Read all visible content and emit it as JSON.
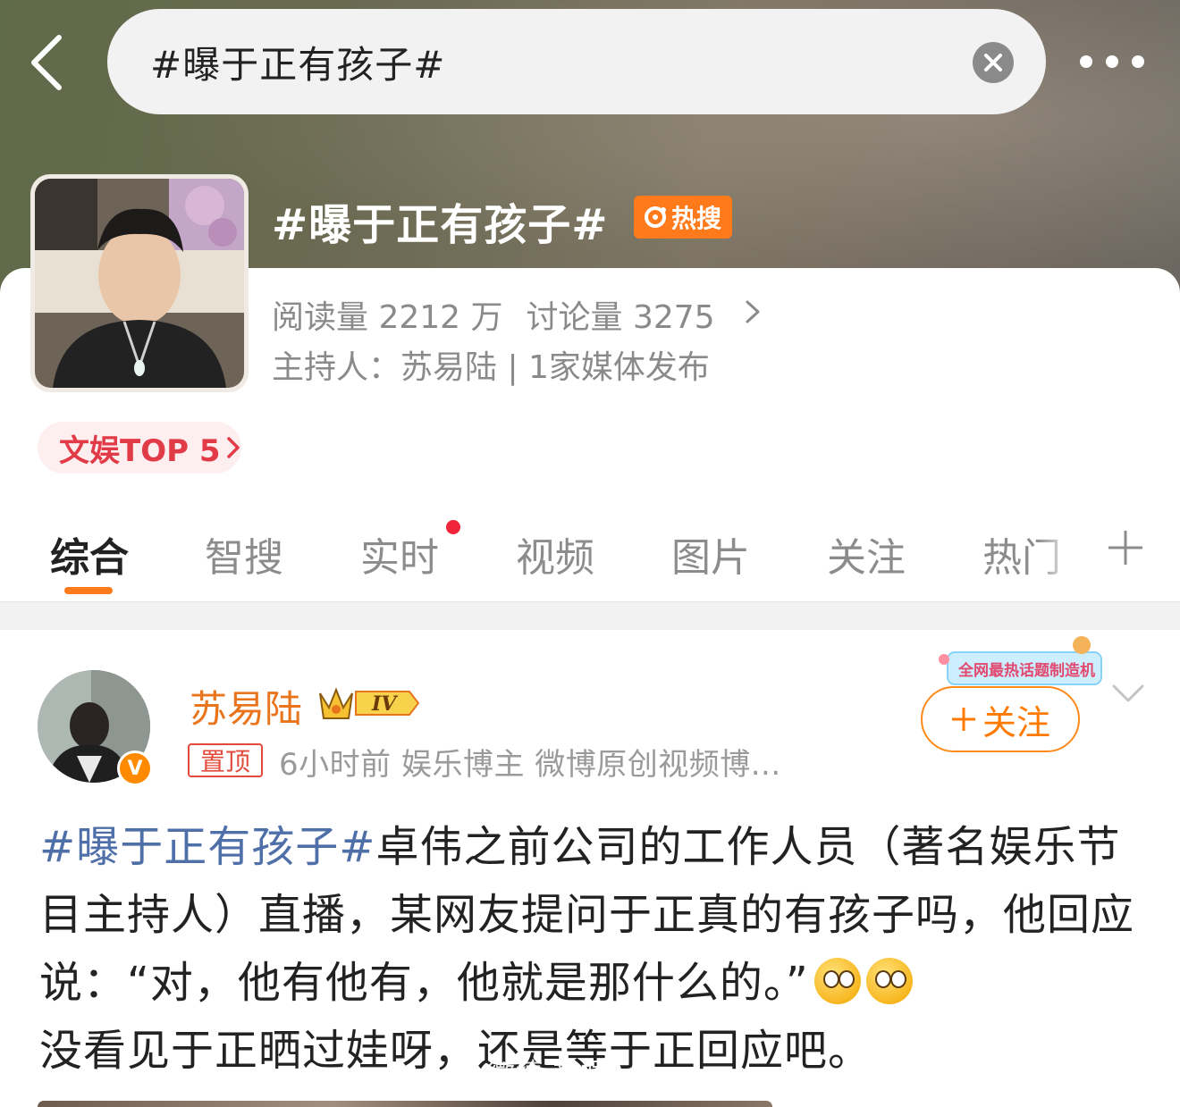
{
  "header": {
    "search_query": "#曝于正有孩子#",
    "back_icon": "chevron-left-icon",
    "clear_icon": "close-icon",
    "more_icon": "more-dots-icon"
  },
  "topic": {
    "title": "#曝于正有孩子#",
    "hot_badge": "热搜",
    "reads": "阅读量 2212 万",
    "discussions": "讨论量 3275",
    "host_line": "主持人：苏易陆 | 1家媒体发布",
    "rank_chip": "文娱TOP 5"
  },
  "tabs": [
    {
      "label": "综合",
      "active": true
    },
    {
      "label": "智搜"
    },
    {
      "label": "实时",
      "has_dot": true
    },
    {
      "label": "视频"
    },
    {
      "label": "图片"
    },
    {
      "label": "关注"
    },
    {
      "label": "热门"
    }
  ],
  "post": {
    "author": "苏易陆",
    "level_badge": "IV",
    "verified_badge": "V",
    "pin_tag": "置顶",
    "meta": "6小时前  娱乐博主 微博原创视频博...",
    "promo": "全网最热话题制造机",
    "follow_label": "关注",
    "hashtag": "#曝于正有孩子#",
    "text": "卓伟之前公司的工作人员（著名娱乐节目主持人）直播，某网友提问于正真的有孩子吗，他回应说：“对，他有他有，他就是那什么的。”",
    "text_tail": "没看见于正晒过娃呀，还是等于正回应吧。",
    "watermark": "微博 文娱"
  },
  "colors": {
    "accent": "#ff7a1a",
    "hashtag": "#4f6fa8",
    "author": "#e8741d",
    "rank_chip": "#e23b48"
  }
}
